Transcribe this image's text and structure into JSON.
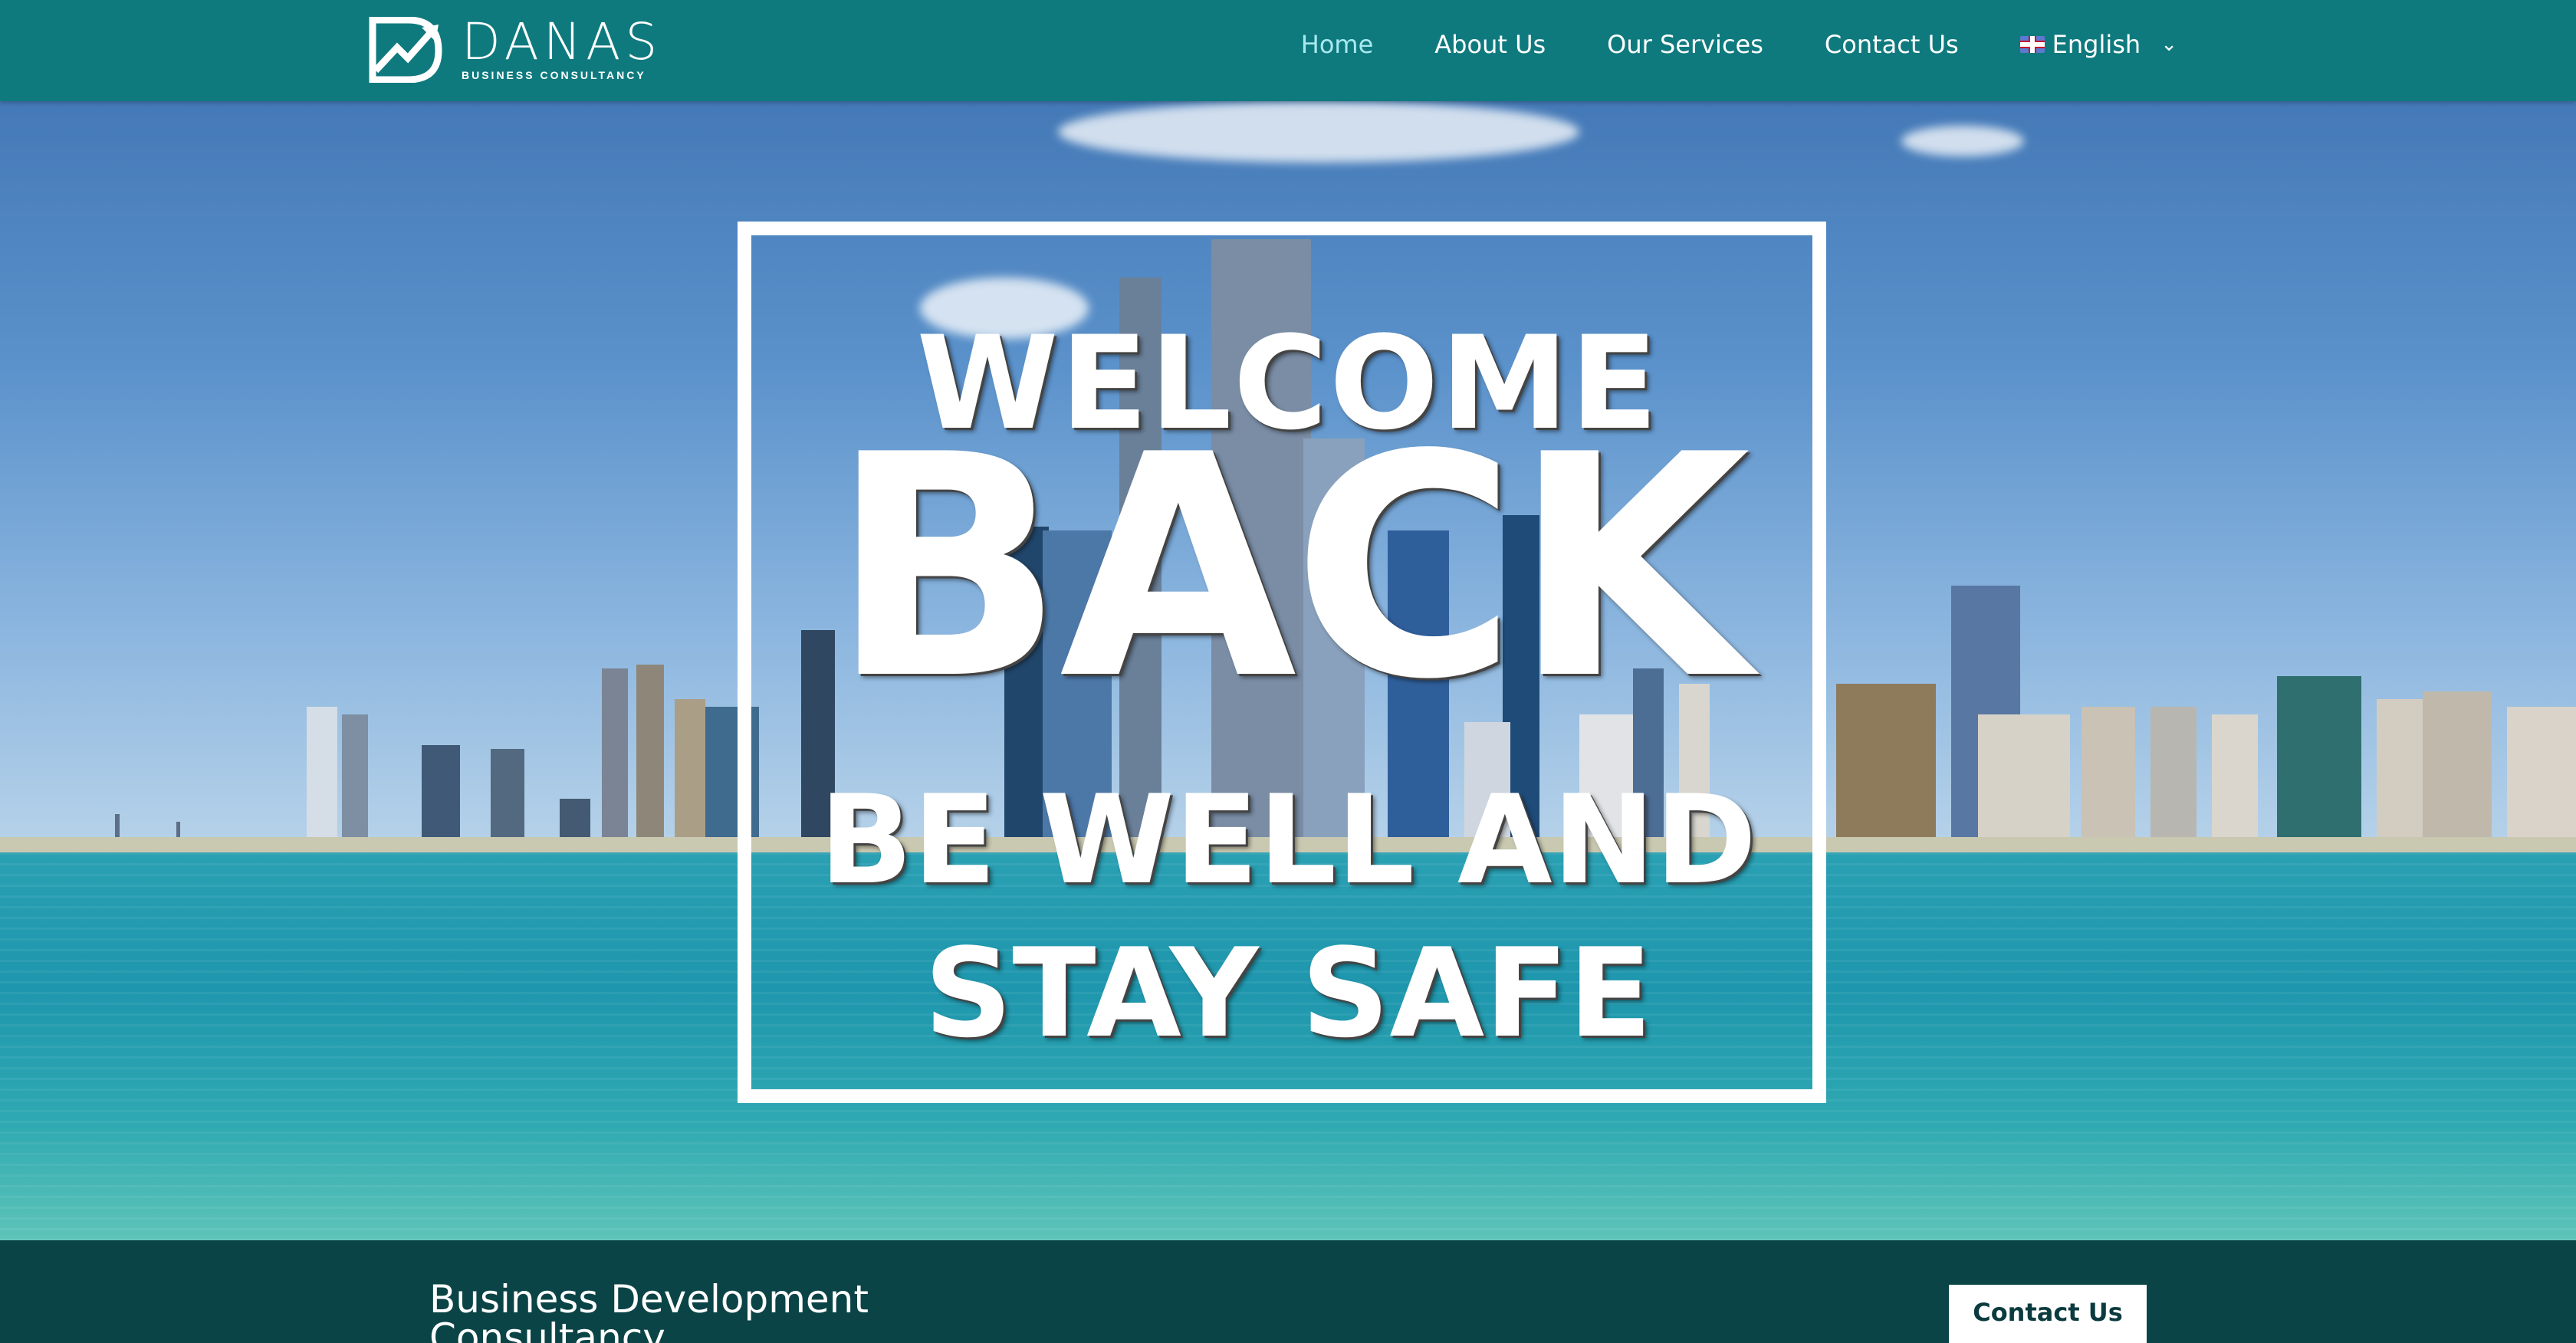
{
  "header": {
    "brand_name": "DANAS",
    "brand_tagline": "BUSINESS CONSULTANCY",
    "nav": [
      {
        "label": "Home",
        "active": true
      },
      {
        "label": "About Us"
      },
      {
        "label": "Our Services"
      },
      {
        "label": "Contact Us"
      }
    ],
    "language": {
      "label": "English",
      "flag": "uk-flag-icon"
    }
  },
  "hero": {
    "line1": "WELCOME",
    "line2": "BACK",
    "line3": "BE WELL AND",
    "line4": "STAY SAFE"
  },
  "band": {
    "title": "Business Development Consultancy",
    "cta_label": "Contact Us"
  },
  "colors": {
    "header_bg": "#0f7a7e",
    "nav_active": "#a8e9ef",
    "band_bg": "#0b4446"
  }
}
